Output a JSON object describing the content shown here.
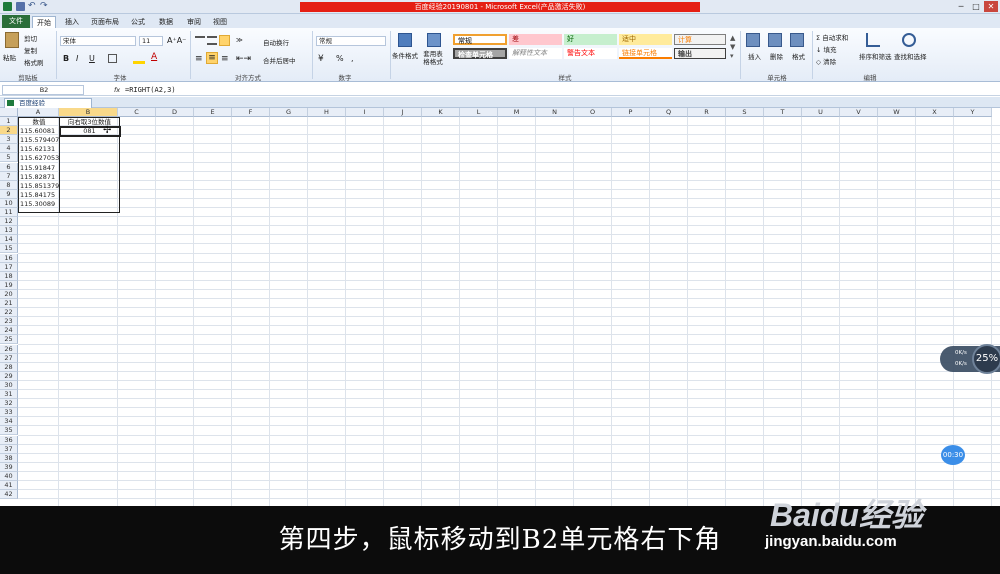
{
  "window": {
    "title": "百度经验20190801 - Microsoft Excel(产品激活失败)",
    "controls": [
      "─",
      "□",
      "✕"
    ]
  },
  "tabs": [
    {
      "label": "文件"
    },
    {
      "label": "开始"
    },
    {
      "label": "插入"
    },
    {
      "label": "页面布局"
    },
    {
      "label": "公式"
    },
    {
      "label": "数据"
    },
    {
      "label": "审阅"
    },
    {
      "label": "视图"
    }
  ],
  "ribbon": {
    "clipboard": {
      "label": "剪贴板",
      "paste": "粘贴",
      "cut": "剪切",
      "copy": "复制",
      "format_painter": "格式刷"
    },
    "font": {
      "label": "字体",
      "name": "宋体",
      "size": "11",
      "bold": "B",
      "italic": "I",
      "underline": "U"
    },
    "alignment": {
      "label": "对齐方式",
      "wrap": "自动换行",
      "merge": "合并后居中"
    },
    "number": {
      "label": "数字",
      "format": "常规",
      "percent": "%",
      "comma": ","
    },
    "styles": {
      "label": "样式",
      "conditional": "条件格式",
      "table": "套用表格格式",
      "cells": [
        {
          "text": "常规",
          "bg": "#ffffff",
          "fg": "#000000"
        },
        {
          "text": "差",
          "bg": "#ffc7ce",
          "fg": "#9c0006"
        },
        {
          "text": "好",
          "bg": "#c6efce",
          "fg": "#006100"
        },
        {
          "text": "适中",
          "bg": "#ffeb9c",
          "fg": "#9c6500"
        },
        {
          "text": "计算",
          "bg": "#f2f2f2",
          "fg": "#fa7d00"
        },
        {
          "text": "检查单元格",
          "bg": "#a5a5a5",
          "fg": "#ffffff"
        },
        {
          "text": "解释性文本",
          "bg": "#ffffff",
          "fg": "#7f7f7f"
        },
        {
          "text": "警告文本",
          "bg": "#ffffff",
          "fg": "#ff0000"
        },
        {
          "text": "链接单元格",
          "bg": "#ffffff",
          "fg": "#fa7d00"
        },
        {
          "text": "输出",
          "bg": "#f2f2f2",
          "fg": "#3f3f3f"
        }
      ]
    },
    "cells": {
      "label": "单元格",
      "insert": "插入",
      "delete": "删除",
      "format": "格式"
    },
    "editing": {
      "label": "编辑",
      "autosum": "自动求和",
      "fill": "填充",
      "clear": "清除",
      "sort": "排序和筛选",
      "find": "查找和选择"
    }
  },
  "formula_bar": {
    "name_box": "B2",
    "fx": "fx",
    "formula": "=RIGHT(A2,3)"
  },
  "workbook_tab": "百度经验20190801.xlsx",
  "sheet": {
    "columns": [
      "A",
      "B",
      "C",
      "D",
      "E",
      "F",
      "G",
      "H",
      "I",
      "J",
      "K",
      "L",
      "M",
      "N",
      "O",
      "P",
      "Q",
      "R",
      "S",
      "T",
      "U",
      "V",
      "W",
      "X",
      "Y"
    ],
    "rows": [
      "1",
      "2",
      "3",
      "4",
      "5",
      "6",
      "7",
      "8",
      "9",
      "10",
      "11",
      "12",
      "13",
      "14",
      "15",
      "16",
      "17",
      "18",
      "19",
      "20",
      "21",
      "22",
      "23",
      "24",
      "25",
      "26",
      "27",
      "28",
      "29",
      "30",
      "31",
      "32",
      "33",
      "34",
      "35",
      "36",
      "37",
      "38",
      "39",
      "40",
      "41",
      "42"
    ],
    "header_a": "数值",
    "header_b": "向右取3位数值",
    "values_a": [
      "115.60081",
      "115.579407",
      "115.62131",
      "115.627053",
      "115.91847",
      "115.82871",
      "115.851379",
      "115.84175",
      "115.30089"
    ],
    "b2": "081"
  },
  "caption": {
    "subtitle": "第四步，鼠标移动到B2单元格右下角",
    "watermark": "Baidu经验",
    "url": "jingyan.baidu.com"
  },
  "widgets": {
    "net_percent": "25%",
    "net_up": "0K/s",
    "net_down": "0K/s",
    "timer": "00:30"
  }
}
